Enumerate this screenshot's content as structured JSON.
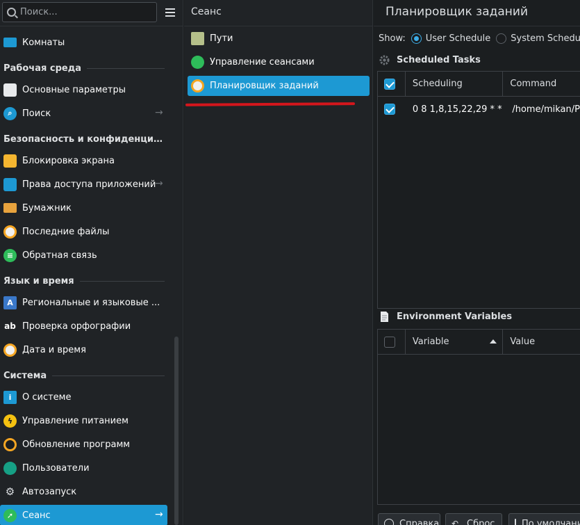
{
  "sidebar": {
    "search_placeholder": "Поиск...",
    "top_item": "Комнаты",
    "categories": {
      "workspace": "Рабочая среда",
      "security": "Безопасность и конфиденциальн...",
      "language": "Язык и время",
      "system": "Система"
    },
    "items": {
      "basic": "Основные параметры",
      "search": "Поиск",
      "lock": "Блокировка экрана",
      "perms": "Права доступа приложений",
      "wallet": "Бумажник",
      "recent": "Последние файлы",
      "feedback": "Обратная связь",
      "regional": "Региональные и языковые ...",
      "spell": "Проверка орфографии",
      "datetime": "Дата и время",
      "about": "О системе",
      "power": "Управление питанием",
      "update": "Обновление программ",
      "users": "Пользователи",
      "autostart": "Автозапуск",
      "session": "Сеанс"
    }
  },
  "middle": {
    "title": "Сеанс",
    "items": {
      "paths": "Пути",
      "sessions": "Управление сеансами",
      "scheduler": "Планировщик заданий"
    }
  },
  "right": {
    "title": "Планировщик заданий",
    "show_label": "Show:",
    "user_schedule": "User Schedule",
    "system_schedule": "System Schedule",
    "tasks": {
      "heading": "Scheduled Tasks",
      "col_scheduling": "Scheduling",
      "col_command": "Command",
      "row_scheduling": "0 8 1,8,15,22,29 * *",
      "row_command": "/home/mikan/Pr"
    },
    "env": {
      "heading": "Environment Variables",
      "col_variable": "Variable",
      "col_value": "Value"
    },
    "buttons": {
      "help": "Справка",
      "reset": "Сброс",
      "defaults": "По умолчанию"
    }
  },
  "colors": {
    "accent": "#1d99d3",
    "annotation_red": "#d4161c"
  }
}
